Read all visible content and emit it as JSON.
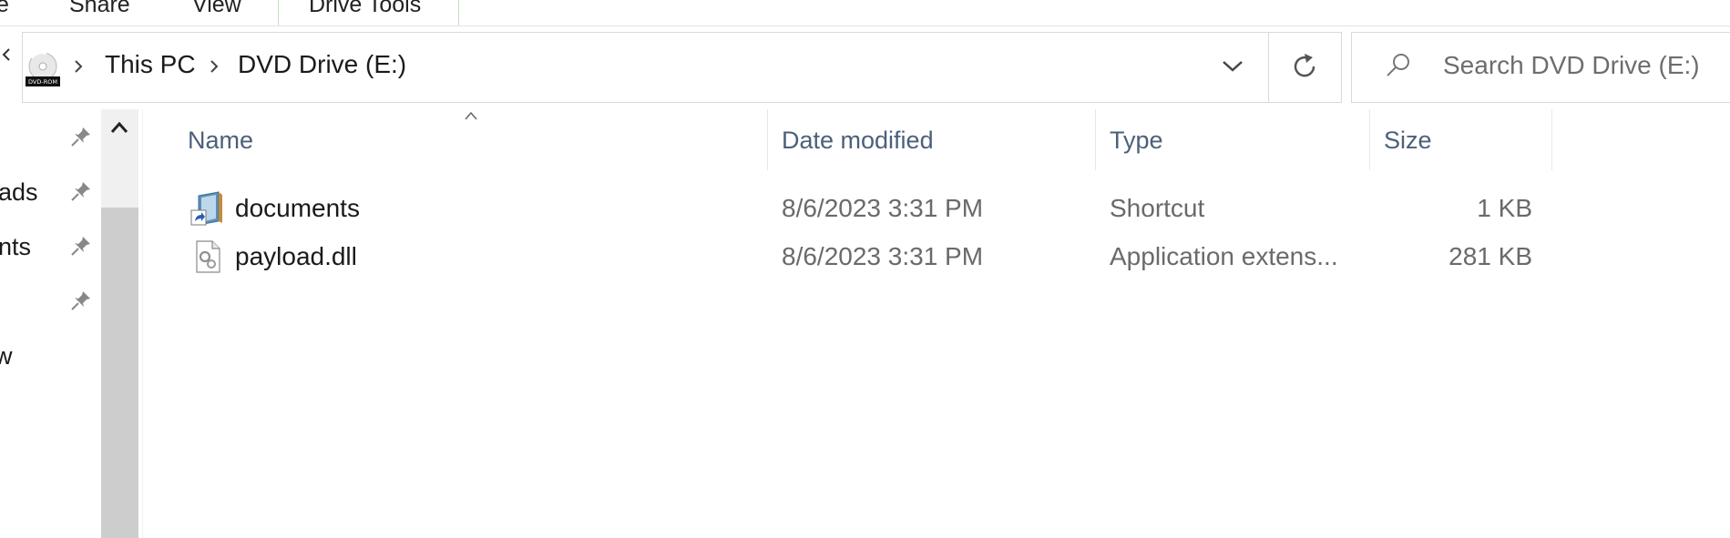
{
  "ribbon": {
    "tabs": [
      "e",
      "Share",
      "View",
      "Drive Tools"
    ]
  },
  "address": {
    "breadcrumbs": [
      "This PC",
      "DVD Drive (E:)"
    ],
    "icon": "dvd-rom-drive-icon",
    "dvd_badge": "DVD-ROM"
  },
  "search": {
    "placeholder": "Search DVD Drive (E:)"
  },
  "nav": {
    "items": [
      "",
      "ads",
      "nts",
      "",
      "w"
    ]
  },
  "columns": {
    "name": "Name",
    "date": "Date modified",
    "type": "Type",
    "size": "Size"
  },
  "files": [
    {
      "name": "documents",
      "date": "8/6/2023 3:31 PM",
      "type": "Shortcut",
      "size": "1 KB",
      "icon": "shortcut-icon"
    },
    {
      "name": "payload.dll",
      "date": "8/6/2023 3:31 PM",
      "type": "Application extens...",
      "size": "281 KB",
      "icon": "dll-file-icon"
    }
  ],
  "colors": {
    "column_header": "#4c607a",
    "scroll_thumb": "#cdcdcd",
    "drive_tools_border": "#bfe4b8"
  }
}
